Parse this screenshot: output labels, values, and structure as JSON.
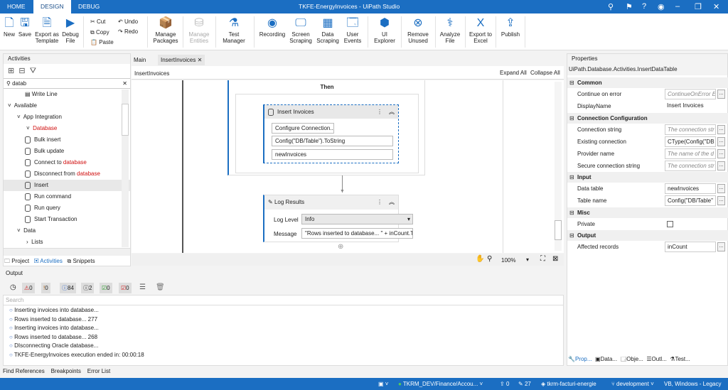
{
  "titlebar": {
    "tabs": [
      "HOME",
      "DESIGN",
      "DEBUG"
    ],
    "title": "TKFE-EnergyInvoices - UiPath Studio"
  },
  "ribbon": {
    "new": "New",
    "save": "Save",
    "export_template": "Export as Template",
    "debug": "Debug File",
    "cut": "Cut",
    "copy": "Copy",
    "paste": "Paste",
    "undo": "Undo",
    "redo": "Redo",
    "manage_packages": "Manage Packages",
    "manage_entities": "Manage Entities",
    "test_manager": "Test Manager",
    "recording": "Recording",
    "screen_scraping": "Screen Scraping",
    "data_scraping": "Data Scraping",
    "user_events": "User Events",
    "ui_explorer": "UI Explorer",
    "remove_unused": "Remove Unused",
    "analyze_file": "Analyze File",
    "export_excel": "Export to Excel",
    "publish": "Publish"
  },
  "activities": {
    "title": "Activities",
    "search": "datab",
    "items": [
      {
        "label": "Write Line",
        "level": 3
      },
      {
        "label": "Available",
        "level": 0
      },
      {
        "label": "App Integration",
        "level": 1
      },
      {
        "label": "Database",
        "level": 2
      },
      {
        "label": "Bulk insert",
        "level": 3
      },
      {
        "label": "Bulk update",
        "level": 3
      },
      {
        "label": "Connect to ",
        "hl": "database",
        "level": 3
      },
      {
        "label": "Disconnect from ",
        "hl": "database",
        "level": 3
      },
      {
        "label": "Insert",
        "level": 3
      },
      {
        "label": "Run command",
        "level": 3
      },
      {
        "label": "Run query",
        "level": 3
      },
      {
        "label": "Start Transaction",
        "level": 3
      },
      {
        "label": "Data",
        "level": 1
      },
      {
        "label": "Lists",
        "level": 2
      }
    ],
    "tabs": [
      "Project",
      "Activities",
      "Snippets"
    ]
  },
  "designer": {
    "tabs": [
      "Main",
      "InsertInvoices"
    ],
    "breadcrumb": "InsertInvoices",
    "expand_all": "Expand All",
    "collapse_all": "Collapse All",
    "then": "Then",
    "insert": {
      "title": "Insert Invoices",
      "configure": "Configure Connection...",
      "table": "Config(\"DB/Table\").ToString",
      "datatable": "newInvoices"
    },
    "log": {
      "title": "Log Results",
      "level_label": "Log Level",
      "level": "Info",
      "message_label": "Message",
      "message": "\"Rows inserted to database... \" + inCount.T"
    },
    "zoom": "100%"
  },
  "properties": {
    "title": "Properties",
    "type": "UiPath.Database.Activities.InsertDataTable",
    "common": "Common",
    "continue_on_error": "Continue on error",
    "continue_ph": "ContinueOnError E",
    "displayname": "DisplayName",
    "displayname_val": "Insert Invoices",
    "conn": "Connection Configuration",
    "conn_string": "Connection string",
    "conn_string_ph": "The connection str",
    "existing": "Existing connection",
    "existing_val": "CType(Config(\"DB",
    "provider": "Provider name",
    "provider_ph": "The name of the d",
    "secure": "Secure connection string",
    "secure_ph": "The connection str",
    "input": "Input",
    "datatable": "Data table",
    "datatable_val": "newInvoices",
    "tablename": "Table name",
    "tablename_val": "Config(\"DB/Table\"",
    "misc": "Misc",
    "private": "Private",
    "output": "Output",
    "affected": "Affected records",
    "affected_val": "inCount",
    "tabs": [
      "Prop...",
      "Data...",
      "Obje...",
      "Outl...",
      "Test..."
    ]
  },
  "output": {
    "title": "Output",
    "counts": [
      "0",
      "0",
      "84",
      "2",
      "0",
      "0"
    ],
    "search_ph": "Search",
    "lines": [
      "Inserting invoices into database...",
      "Rows inserted to database... 277",
      "Inserting invoices into database...",
      "Rows inserted to database... 268",
      "DIsconnecting Oracle database...",
      "TKFE-EnergyInvoices execution ended in: 00:00:18"
    ]
  },
  "bottom_tabs": [
    "Find References",
    "Breakpoints",
    "Error List"
  ],
  "status": {
    "orch": "TKRM_DEV/Finance/Accou...",
    "publish": "0",
    "edits": "27",
    "project": "tkrm-facturi-energie",
    "branch": "development",
    "lang": "VB, Windows - Legacy"
  }
}
